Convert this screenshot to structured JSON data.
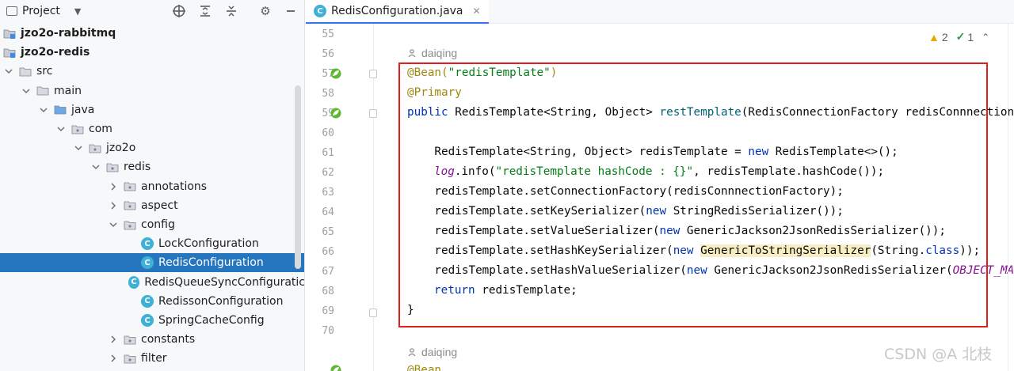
{
  "project_panel": {
    "title": "Project",
    "tree": [
      {
        "label": "jzo2o-rabbitmq",
        "bold": true,
        "kind": "module"
      },
      {
        "label": "jzo2o-redis",
        "bold": true,
        "kind": "module"
      },
      {
        "label": "src",
        "kind": "folder",
        "expanded": true
      },
      {
        "label": "main",
        "kind": "folder",
        "expanded": true
      },
      {
        "label": "java",
        "kind": "source-folder",
        "expanded": true
      },
      {
        "label": "com",
        "kind": "package",
        "expanded": true
      },
      {
        "label": "jzo2o",
        "kind": "package",
        "expanded": true
      },
      {
        "label": "redis",
        "kind": "package",
        "expanded": true
      },
      {
        "label": "annotations",
        "kind": "package",
        "expanded": false
      },
      {
        "label": "aspect",
        "kind": "package",
        "expanded": false
      },
      {
        "label": "config",
        "kind": "package",
        "expanded": true
      },
      {
        "label": "LockConfiguration",
        "kind": "class"
      },
      {
        "label": "RedisConfiguration",
        "kind": "class",
        "selected": true
      },
      {
        "label": "RedisQueueSyncConfiguratic",
        "kind": "class"
      },
      {
        "label": "RedissonConfiguration",
        "kind": "class"
      },
      {
        "label": "SpringCacheConfig",
        "kind": "class"
      },
      {
        "label": "constants",
        "kind": "package",
        "expanded": false
      },
      {
        "label": "filter",
        "kind": "package",
        "expanded": false
      }
    ],
    "class_icon_letter": "C"
  },
  "editor": {
    "tab_label": "RedisConfiguration.java",
    "tab_close": "✕",
    "inspections": {
      "warnings": "2",
      "ok": "1"
    },
    "author_1": "daiqing",
    "author_2": "daiqing",
    "line_numbers": [
      "55",
      "56",
      "57",
      "58",
      "59",
      "60",
      "61",
      "62",
      "63",
      "64",
      "65",
      "66",
      "67",
      "68",
      "69",
      "70"
    ],
    "code": {
      "l56_ann": "@Bean(",
      "l56_str": "\"redisTemplate\"",
      "l56_end": ")",
      "l57_ann": "@Primary",
      "l58_kw": "public",
      "l58_a": " RedisTemplate<String, Object> ",
      "l58_fn": "restTemplate",
      "l58_b": "(RedisConnectionFactory redisConnnectionFa",
      "l60_a": "    RedisTemplate<String, Object> redisTemplate = ",
      "l60_kw": "new",
      "l60_b": " RedisTemplate<>();",
      "l61_stf": "log",
      "l61_a": ".info(",
      "l61_str": "\"redisTemplate hashCode : {}\"",
      "l61_b": ", redisTemplate.hashCode());",
      "l62": "    redisTemplate.setConnectionFactory(redisConnnectionFactory);",
      "l63_a": "    redisTemplate.setKeySerializer(",
      "l63_kw": "new",
      "l63_b": " StringRedisSerializer());",
      "l64_a": "    redisTemplate.setValueSerializer(",
      "l64_kw": "new",
      "l64_b": " GenericJackson2JsonRedisSerializer());",
      "l65_a": "    redisTemplate.setHashKeySerializer(",
      "l65_kw": "new",
      "l65_hl": "GenericToStringSerializer",
      "l65_b": "(String.",
      "l65_kw2": "class",
      "l65_c": "));",
      "l66_a": "    redisTemplate.setHashValueSerializer(",
      "l66_kw": "new",
      "l66_b": " GenericJackson2JsonRedisSerializer(",
      "l66_stf": "OBJECT_MAP",
      "l67_kw": "return",
      "l67_a": " redisTemplate;",
      "l68": "}",
      "l70_ann": "@Bean"
    }
  },
  "watermark": "CSDN @A 北枝",
  "colors": {
    "selection": "#2675bf",
    "highlight_box": "#e0201c",
    "keyword": "#0033b3",
    "string": "#067d17",
    "annotation": "#9e880d"
  }
}
